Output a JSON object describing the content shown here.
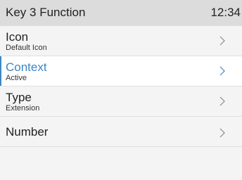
{
  "header": {
    "title": "Key 3 Function",
    "time": "12:34"
  },
  "colors": {
    "accent": "#3d86c6",
    "header_bg": "#dcdcdc",
    "list_bg": "#f4f4f4",
    "selected_bg": "#ffffff"
  },
  "menu": {
    "items": [
      {
        "label": "Icon",
        "value": "Default Icon",
        "icon": "chevron-right-icon"
      },
      {
        "label": "Context",
        "value": "Active",
        "icon": "chevron-right-icon",
        "selected": true
      },
      {
        "label": "Type",
        "value": "Extension",
        "icon": "chevron-right-icon"
      },
      {
        "label": "Number",
        "value": "",
        "icon": "chevron-right-icon"
      }
    ]
  }
}
